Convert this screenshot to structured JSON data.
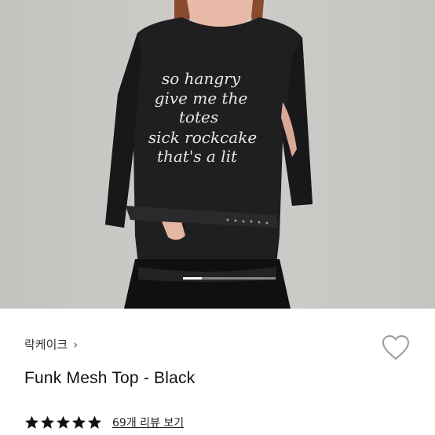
{
  "product": {
    "brand": "락케이크",
    "brand_chevron": "›",
    "title": "Funk Mesh Top - Black",
    "rating": 5,
    "rating_max": 5,
    "review_link": "69개 리뷰 보기"
  },
  "image": {
    "shirt_print_lines": [
      "so hangry",
      "give me the",
      "totes",
      "sick rockcake",
      "that's a lit"
    ],
    "carousel_position": 0.2
  },
  "colors": {
    "star": "#111111",
    "shirt": "#1f1f21",
    "background": "#c9c7c4"
  },
  "icons": {
    "wishlist": "heart-outline-icon",
    "star": "star-filled-icon"
  }
}
